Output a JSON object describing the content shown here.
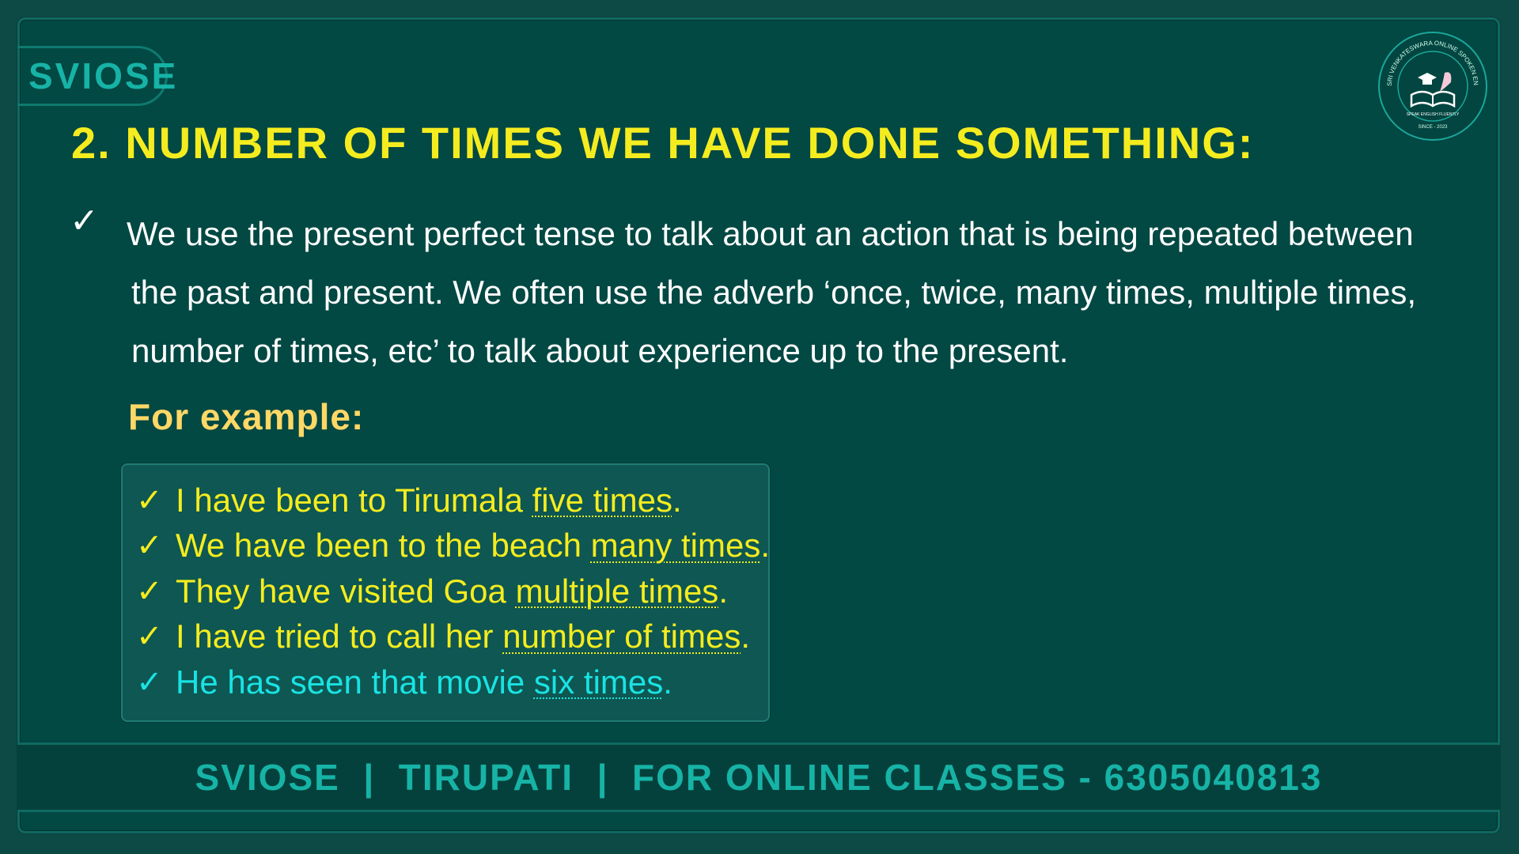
{
  "brand_tag": "SVIOSE",
  "logo": {
    "ring_text": "SRI VENKATESWARA ONLINE SPOKEN ENGLISH SCHOOL",
    "inner_text": "SPEAK ENGLISH FLUENTLY",
    "since_text": "SINCE - 2023"
  },
  "title": "2. NUMBER OF TIMES WE HAVE DONE SOMETHING:",
  "main_point": {
    "check": "✓",
    "line1": "We use the present perfect tense to talk about an action that is being repeated between",
    "line2": "the past and present. We often use the adverb ‘once, twice, many times, multiple times,",
    "line3": "number of times, etc’ to talk about experience up to the present."
  },
  "for_example_label": "For example:",
  "examples": [
    {
      "check": "✓",
      "before": "I have been to Tirumala ",
      "highlight": "five times",
      "after": "."
    },
    {
      "check": "✓",
      "before": "We have been to the beach ",
      "highlight": "many times",
      "after": "."
    },
    {
      "check": "✓",
      "before": "They have visited Goa ",
      "highlight": "multiple times",
      "after": "."
    },
    {
      "check": "✓",
      "before": "I have tried to call her ",
      "highlight": "number of times",
      "after": "."
    },
    {
      "check": "✓",
      "before": "He has seen that movie ",
      "highlight": "six times",
      "after": "."
    }
  ],
  "footer": "SVIOSE  |  TIRUPATI  |  FOR ONLINE CLASSES - 6305040813",
  "colors": {
    "background": "#024843",
    "title": "#f5ec1f",
    "accent": "#16b3a6",
    "example_label": "#ffd866",
    "example_text": "#f5ec1f",
    "example_last": "#19e3e3"
  }
}
